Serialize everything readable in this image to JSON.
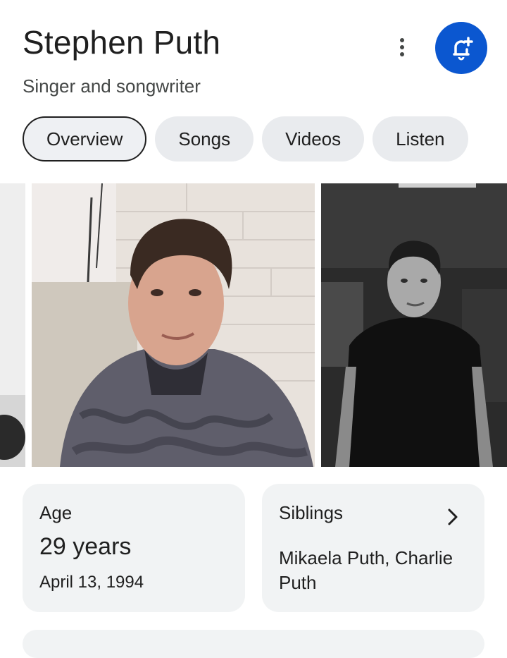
{
  "header": {
    "title": "Stephen Puth",
    "subtitle": "Singer and songwriter",
    "more_icon": "more-vert-icon",
    "follow_icon": "bell-plus-icon"
  },
  "tabs": [
    {
      "label": "Overview",
      "active": true
    },
    {
      "label": "Songs",
      "active": false
    },
    {
      "label": "Videos",
      "active": false
    },
    {
      "label": "Listen",
      "active": false
    }
  ],
  "gallery": {
    "images": [
      "partial-photo",
      "color-portrait-gray-hoodie",
      "black-white-portrait-black-tshirt"
    ]
  },
  "facts": {
    "age": {
      "label": "Age",
      "value": "29 years",
      "detail": "April 13, 1994"
    },
    "siblings": {
      "label": "Siblings",
      "value": "Mikaela Puth, Charlie Puth",
      "chevron_icon": "chevron-right-icon"
    }
  },
  "colors": {
    "accent": "#0b57d0",
    "chip_bg": "#e9ebee",
    "card_bg": "#f1f3f4",
    "text": "#1f1f1f",
    "secondary_text": "#444746"
  }
}
